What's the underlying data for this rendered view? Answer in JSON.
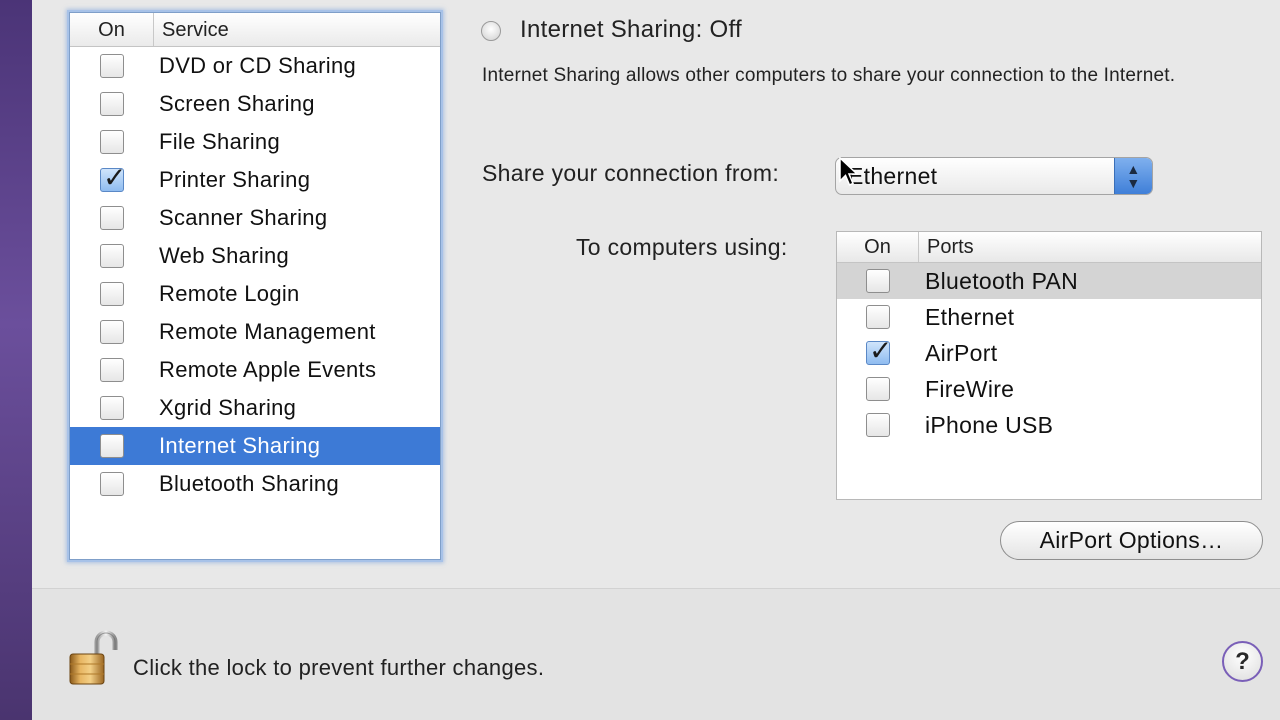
{
  "services": {
    "header_on": "On",
    "header_service": "Service",
    "items": [
      {
        "label": "DVD or CD Sharing",
        "on": false,
        "selected": false
      },
      {
        "label": "Screen Sharing",
        "on": false,
        "selected": false
      },
      {
        "label": "File Sharing",
        "on": false,
        "selected": false
      },
      {
        "label": "Printer Sharing",
        "on": true,
        "selected": false
      },
      {
        "label": "Scanner Sharing",
        "on": false,
        "selected": false
      },
      {
        "label": "Web Sharing",
        "on": false,
        "selected": false
      },
      {
        "label": "Remote Login",
        "on": false,
        "selected": false
      },
      {
        "label": "Remote Management",
        "on": false,
        "selected": false
      },
      {
        "label": "Remote Apple Events",
        "on": false,
        "selected": false
      },
      {
        "label": "Xgrid Sharing",
        "on": false,
        "selected": false
      },
      {
        "label": "Internet Sharing",
        "on": false,
        "selected": true
      },
      {
        "label": "Bluetooth Sharing",
        "on": false,
        "selected": false
      }
    ]
  },
  "detail": {
    "status_title": "Internet Sharing: Off",
    "description": "Internet Sharing allows other computers to share your connection to the Internet.",
    "share_from_label": "Share your connection from:",
    "share_from_value": "Ethernet",
    "to_computers_label": "To computers using:",
    "ports_header_on": "On",
    "ports_header_ports": "Ports",
    "ports": [
      {
        "label": "Bluetooth PAN",
        "on": false,
        "highlight": true
      },
      {
        "label": "Ethernet",
        "on": false,
        "highlight": false
      },
      {
        "label": "AirPort",
        "on": true,
        "highlight": false
      },
      {
        "label": "FireWire",
        "on": false,
        "highlight": false
      },
      {
        "label": "iPhone USB",
        "on": false,
        "highlight": false
      }
    ],
    "airport_options_label": "AirPort Options…"
  },
  "footer": {
    "lock_text": "Click the lock to prevent further changes.",
    "help_label": "?"
  },
  "colors": {
    "selection": "#3d7ad6",
    "checked_fill": "#8fbcf0",
    "focus_ring": "#a7c2e8"
  }
}
